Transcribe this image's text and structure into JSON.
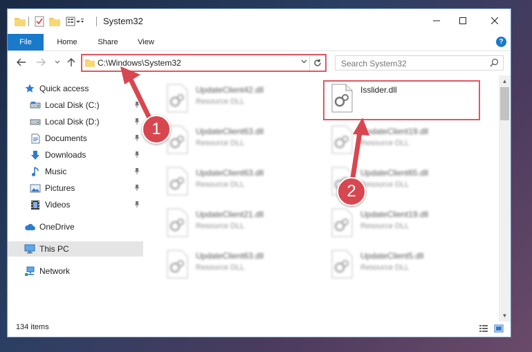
{
  "window": {
    "title": "System32"
  },
  "ribbon": {
    "tabs": [
      {
        "label": "File"
      },
      {
        "label": "Home"
      },
      {
        "label": "Share"
      },
      {
        "label": "View"
      }
    ],
    "help_label": "?"
  },
  "nav": {
    "address": "C:\\Windows\\System32",
    "search_placeholder": "Search System32"
  },
  "sidebar": {
    "items": [
      {
        "label": "Quick access",
        "icon": "star-icon"
      },
      {
        "label": "Local Disk (C:)",
        "icon": "drive-icon",
        "pinned": true
      },
      {
        "label": "Local Disk (D:)",
        "icon": "drive-icon",
        "pinned": true
      },
      {
        "label": "Documents",
        "icon": "documents-icon",
        "pinned": true
      },
      {
        "label": "Downloads",
        "icon": "downloads-icon",
        "pinned": true
      },
      {
        "label": "Music",
        "icon": "music-icon",
        "pinned": true
      },
      {
        "label": "Pictures",
        "icon": "pictures-icon",
        "pinned": true
      },
      {
        "label": "Videos",
        "icon": "videos-icon",
        "pinned": true
      },
      {
        "label": "OneDrive",
        "icon": "cloud-icon"
      },
      {
        "label": "This PC",
        "icon": "computer-icon",
        "selected": true
      },
      {
        "label": "Network",
        "icon": "network-icon"
      }
    ]
  },
  "files": {
    "left": [
      {
        "name": "UpdateClient42.dll",
        "type": "Resource DLL"
      },
      {
        "name": "UpdateClient63.dll",
        "type": "Resource DLL"
      },
      {
        "name": "UpdateClient63.dll",
        "type": "Resource DLL"
      },
      {
        "name": "UpdateClient21.dll",
        "type": "Resource DLL"
      },
      {
        "name": "UpdateClient63.dll",
        "type": "Resource DLL"
      }
    ],
    "right": [
      {
        "name": "Isslider.dll",
        "type": ""
      },
      {
        "name": "UpdateClient19.dll",
        "type": "Resource DLL"
      },
      {
        "name": "UpdateClient65.dll",
        "type": "Resource DLL"
      },
      {
        "name": "UpdateClient19.dll",
        "type": "Resource DLL"
      },
      {
        "name": "UpdateClient5.dll",
        "type": "Resource DLL"
      }
    ]
  },
  "status": {
    "item_count": "134 items"
  },
  "annotations": {
    "step1": "1",
    "step2": "2"
  },
  "colors": {
    "accent": "#1979ca",
    "highlight": "#e05660",
    "badge": "#d8474f"
  }
}
